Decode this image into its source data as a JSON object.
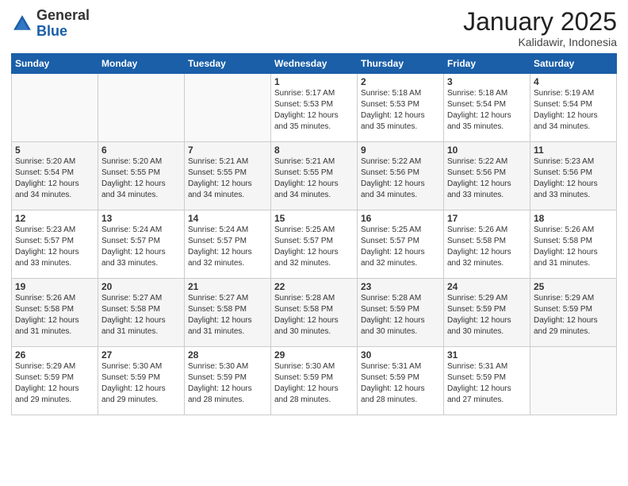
{
  "logo": {
    "general": "General",
    "blue": "Blue"
  },
  "header": {
    "month": "January 2025",
    "location": "Kalidawir, Indonesia"
  },
  "weekdays": [
    "Sunday",
    "Monday",
    "Tuesday",
    "Wednesday",
    "Thursday",
    "Friday",
    "Saturday"
  ],
  "weeks": [
    [
      {
        "day": "",
        "sunrise": "",
        "sunset": "",
        "daylight": ""
      },
      {
        "day": "",
        "sunrise": "",
        "sunset": "",
        "daylight": ""
      },
      {
        "day": "",
        "sunrise": "",
        "sunset": "",
        "daylight": ""
      },
      {
        "day": "1",
        "sunrise": "Sunrise: 5:17 AM",
        "sunset": "Sunset: 5:53 PM",
        "daylight": "Daylight: 12 hours and 35 minutes."
      },
      {
        "day": "2",
        "sunrise": "Sunrise: 5:18 AM",
        "sunset": "Sunset: 5:53 PM",
        "daylight": "Daylight: 12 hours and 35 minutes."
      },
      {
        "day": "3",
        "sunrise": "Sunrise: 5:18 AM",
        "sunset": "Sunset: 5:54 PM",
        "daylight": "Daylight: 12 hours and 35 minutes."
      },
      {
        "day": "4",
        "sunrise": "Sunrise: 5:19 AM",
        "sunset": "Sunset: 5:54 PM",
        "daylight": "Daylight: 12 hours and 34 minutes."
      }
    ],
    [
      {
        "day": "5",
        "sunrise": "Sunrise: 5:20 AM",
        "sunset": "Sunset: 5:54 PM",
        "daylight": "Daylight: 12 hours and 34 minutes."
      },
      {
        "day": "6",
        "sunrise": "Sunrise: 5:20 AM",
        "sunset": "Sunset: 5:55 PM",
        "daylight": "Daylight: 12 hours and 34 minutes."
      },
      {
        "day": "7",
        "sunrise": "Sunrise: 5:21 AM",
        "sunset": "Sunset: 5:55 PM",
        "daylight": "Daylight: 12 hours and 34 minutes."
      },
      {
        "day": "8",
        "sunrise": "Sunrise: 5:21 AM",
        "sunset": "Sunset: 5:55 PM",
        "daylight": "Daylight: 12 hours and 34 minutes."
      },
      {
        "day": "9",
        "sunrise": "Sunrise: 5:22 AM",
        "sunset": "Sunset: 5:56 PM",
        "daylight": "Daylight: 12 hours and 34 minutes."
      },
      {
        "day": "10",
        "sunrise": "Sunrise: 5:22 AM",
        "sunset": "Sunset: 5:56 PM",
        "daylight": "Daylight: 12 hours and 33 minutes."
      },
      {
        "day": "11",
        "sunrise": "Sunrise: 5:23 AM",
        "sunset": "Sunset: 5:56 PM",
        "daylight": "Daylight: 12 hours and 33 minutes."
      }
    ],
    [
      {
        "day": "12",
        "sunrise": "Sunrise: 5:23 AM",
        "sunset": "Sunset: 5:57 PM",
        "daylight": "Daylight: 12 hours and 33 minutes."
      },
      {
        "day": "13",
        "sunrise": "Sunrise: 5:24 AM",
        "sunset": "Sunset: 5:57 PM",
        "daylight": "Daylight: 12 hours and 33 minutes."
      },
      {
        "day": "14",
        "sunrise": "Sunrise: 5:24 AM",
        "sunset": "Sunset: 5:57 PM",
        "daylight": "Daylight: 12 hours and 32 minutes."
      },
      {
        "day": "15",
        "sunrise": "Sunrise: 5:25 AM",
        "sunset": "Sunset: 5:57 PM",
        "daylight": "Daylight: 12 hours and 32 minutes."
      },
      {
        "day": "16",
        "sunrise": "Sunrise: 5:25 AM",
        "sunset": "Sunset: 5:57 PM",
        "daylight": "Daylight: 12 hours and 32 minutes."
      },
      {
        "day": "17",
        "sunrise": "Sunrise: 5:26 AM",
        "sunset": "Sunset: 5:58 PM",
        "daylight": "Daylight: 12 hours and 32 minutes."
      },
      {
        "day": "18",
        "sunrise": "Sunrise: 5:26 AM",
        "sunset": "Sunset: 5:58 PM",
        "daylight": "Daylight: 12 hours and 31 minutes."
      }
    ],
    [
      {
        "day": "19",
        "sunrise": "Sunrise: 5:26 AM",
        "sunset": "Sunset: 5:58 PM",
        "daylight": "Daylight: 12 hours and 31 minutes."
      },
      {
        "day": "20",
        "sunrise": "Sunrise: 5:27 AM",
        "sunset": "Sunset: 5:58 PM",
        "daylight": "Daylight: 12 hours and 31 minutes."
      },
      {
        "day": "21",
        "sunrise": "Sunrise: 5:27 AM",
        "sunset": "Sunset: 5:58 PM",
        "daylight": "Daylight: 12 hours and 31 minutes."
      },
      {
        "day": "22",
        "sunrise": "Sunrise: 5:28 AM",
        "sunset": "Sunset: 5:58 PM",
        "daylight": "Daylight: 12 hours and 30 minutes."
      },
      {
        "day": "23",
        "sunrise": "Sunrise: 5:28 AM",
        "sunset": "Sunset: 5:59 PM",
        "daylight": "Daylight: 12 hours and 30 minutes."
      },
      {
        "day": "24",
        "sunrise": "Sunrise: 5:29 AM",
        "sunset": "Sunset: 5:59 PM",
        "daylight": "Daylight: 12 hours and 30 minutes."
      },
      {
        "day": "25",
        "sunrise": "Sunrise: 5:29 AM",
        "sunset": "Sunset: 5:59 PM",
        "daylight": "Daylight: 12 hours and 29 minutes."
      }
    ],
    [
      {
        "day": "26",
        "sunrise": "Sunrise: 5:29 AM",
        "sunset": "Sunset: 5:59 PM",
        "daylight": "Daylight: 12 hours and 29 minutes."
      },
      {
        "day": "27",
        "sunrise": "Sunrise: 5:30 AM",
        "sunset": "Sunset: 5:59 PM",
        "daylight": "Daylight: 12 hours and 29 minutes."
      },
      {
        "day": "28",
        "sunrise": "Sunrise: 5:30 AM",
        "sunset": "Sunset: 5:59 PM",
        "daylight": "Daylight: 12 hours and 28 minutes."
      },
      {
        "day": "29",
        "sunrise": "Sunrise: 5:30 AM",
        "sunset": "Sunset: 5:59 PM",
        "daylight": "Daylight: 12 hours and 28 minutes."
      },
      {
        "day": "30",
        "sunrise": "Sunrise: 5:31 AM",
        "sunset": "Sunset: 5:59 PM",
        "daylight": "Daylight: 12 hours and 28 minutes."
      },
      {
        "day": "31",
        "sunrise": "Sunrise: 5:31 AM",
        "sunset": "Sunset: 5:59 PM",
        "daylight": "Daylight: 12 hours and 27 minutes."
      },
      {
        "day": "",
        "sunrise": "",
        "sunset": "",
        "daylight": ""
      }
    ]
  ]
}
